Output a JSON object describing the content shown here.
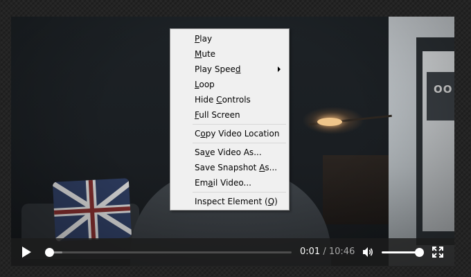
{
  "video": {
    "current_time": "0:01",
    "separator": "/",
    "duration": "10:46",
    "progress_fraction": 0.002,
    "buffered_fraction": 0.07,
    "volume_fraction": 1.0,
    "poster_text": "OO"
  },
  "icons": {
    "play": "play-icon",
    "volume": "speaker-icon",
    "fullscreen": "fullscreen-icon",
    "submenu": "chevron-right-icon"
  },
  "colors": {
    "menu_bg": "#f0f0f0",
    "menu_border": "#979797",
    "controls_bg": "#1c1c1c",
    "control_fg": "#ffffff",
    "duration_fg": "#a8a8a8"
  },
  "context_menu": {
    "groups": [
      [
        {
          "pre": "",
          "key": "P",
          "post": "lay",
          "submenu": false
        },
        {
          "pre": "",
          "key": "M",
          "post": "ute",
          "submenu": false
        },
        {
          "pre": "Play Spee",
          "key": "d",
          "post": "",
          "submenu": true
        },
        {
          "pre": "",
          "key": "L",
          "post": "oop",
          "submenu": false
        },
        {
          "pre": "Hide ",
          "key": "C",
          "post": "ontrols",
          "submenu": false
        },
        {
          "pre": "",
          "key": "F",
          "post": "ull Screen",
          "submenu": false
        }
      ],
      [
        {
          "pre": "C",
          "key": "o",
          "post": "py Video Location",
          "submenu": false
        }
      ],
      [
        {
          "pre": "Sa",
          "key": "v",
          "post": "e Video As...",
          "submenu": false
        },
        {
          "pre": "Save Snapshot ",
          "key": "A",
          "post": "s...",
          "submenu": false
        },
        {
          "pre": "Em",
          "key": "a",
          "post": "il Video...",
          "submenu": false
        }
      ],
      [
        {
          "pre": "Inspect Element (",
          "key": "Q",
          "post": ")",
          "submenu": false
        }
      ]
    ]
  }
}
